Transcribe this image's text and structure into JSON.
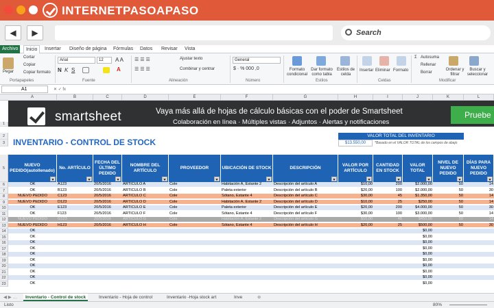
{
  "brand": {
    "name": "INTERNETPASOAPASO"
  },
  "browser": {
    "search_label": "Search"
  },
  "ribbon": {
    "tabs": [
      "Archivo",
      "Inicio",
      "Insertar",
      "Diseño de página",
      "Fórmulas",
      "Datos",
      "Revisar",
      "Vista"
    ],
    "paste": "Pegar",
    "clip": [
      "Cortar",
      "Copiar",
      "Copiar formato"
    ],
    "font_name": "Arial",
    "font_size": "12",
    "wrap": "Ajustar texto",
    "merge": "Combinar y centrar",
    "number_format": "General",
    "cond_format": "Formato condicional",
    "table_format": "Dar formato como tabla",
    "cell_styles": "Estilos de celda",
    "insert": "Insertar",
    "delete": "Eliminar",
    "format": "Formato",
    "autosum": "Autosuma",
    "fill": "Rellenar",
    "clear": "Borrar",
    "sort": "Ordenar y filtrar",
    "find": "Buscar y seleccionar",
    "groups": [
      "Portapapeles",
      "Fuente",
      "Alineación",
      "Número",
      "Estilos",
      "Celdas",
      "Modificar"
    ]
  },
  "formula_bar": {
    "cell_ref": "A1"
  },
  "columns": [
    "A",
    "B",
    "C",
    "D",
    "E",
    "F",
    "G",
    "H",
    "I",
    "J",
    "K",
    "L"
  ],
  "banner": {
    "logo": "smartsheet",
    "line1": "Vaya más allá de hojas de cálculo básicas con el poder de Smartsheet",
    "line2": "Colaboración en línea · Múltiples vistas · Adjuntos · Alertas y notificaciones",
    "cta": "Pruebe"
  },
  "inventory": {
    "title": "INVENTARIO - CONTROL DE STOCK",
    "total_label": "VALOR TOTAL DEL INVENTARIO",
    "total_value": "$13.550,00",
    "total_note": "*Basado en el VALOR TOTAL de los campos de abajo",
    "headers": [
      "NUEVO PEDIDO(autollenado)",
      "No. ARTÍCULO",
      "FECHA DEL ÚLTIMO PEDIDO",
      "NOMBRE DEL ARTÍCULO",
      "PROVEEDOR",
      "UBICACIÓN DE STOCK",
      "DESCRIPCIÓN",
      "VALOR POR ARTÍCULO",
      "CANTIDAD EN STOCK",
      "VALOR TOTAL",
      "NIVEL DE NUEVO PEDIDO",
      "DÍAS PARA NUEVO PEDIDO"
    ],
    "rows": [
      {
        "status": "OK",
        "item": "A123",
        "date": "20/5/2016",
        "name": "ARTÍCULO A",
        "supplier": "Cole",
        "location": "Habitación A, Estante 2",
        "desc": "Descripción del artículo A",
        "unit": "$10,00",
        "qty": "200",
        "total": "$2.000,00",
        "level": "50",
        "days": "14"
      },
      {
        "status": "OK",
        "item": "B123",
        "date": "20/5/2016",
        "name": "ARTÍCULO B",
        "supplier": "Cole",
        "location": "Paleta exterior",
        "desc": "Descripción del artículo B",
        "unit": "$20,00",
        "qty": "100",
        "total": "$2.000,00",
        "level": "50",
        "days": "30"
      },
      {
        "status": "NUEVO PEDIDO",
        "item": "C123",
        "date": "20/5/2016",
        "name": "ARTÍCULO C",
        "supplier": "Cole",
        "location": "Sótano, Estante 4",
        "desc": "Descripción del artículo C",
        "unit": "$30,00",
        "qty": "45",
        "total": "$1.350,00",
        "level": "50",
        "days": "14"
      },
      {
        "status": "NUEVO PEDIDO",
        "item": "D123",
        "date": "20/5/2016",
        "name": "ARTÍCULO D",
        "supplier": "Cole",
        "location": "Habitación A, Estante 2",
        "desc": "Descripción del artículo D",
        "unit": "$10,00",
        "qty": "25",
        "total": "$250,00",
        "level": "50",
        "days": "14"
      },
      {
        "status": "OK",
        "item": "E123",
        "date": "20/5/2016",
        "name": "ARTÍCULO E",
        "supplier": "Cole",
        "location": "Paleta exterior",
        "desc": "Descripción del artículo E",
        "unit": "$20,00",
        "qty": "200",
        "total": "$4.000,00",
        "level": "50",
        "days": "30"
      },
      {
        "status": "OK",
        "item": "F123",
        "date": "20/5/2016",
        "name": "ARTÍCULO F",
        "supplier": "Cole",
        "location": "Sótano, Estante 4",
        "desc": "Descripción del artículo F",
        "unit": "$30,00",
        "qty": "100",
        "total": "$3.000,00",
        "level": "50",
        "days": "14"
      },
      {
        "status": "NUEVO PEDIDO",
        "item": "G123",
        "date": "20/5/2016",
        "name": "ARTÍCULO G",
        "supplier": "Cole",
        "location": "Habitación A, Estante 2",
        "desc": "Descripción del artículo G",
        "unit": "$10,00",
        "qty": "45",
        "total": "$450,00",
        "level": "50",
        "days": "14"
      },
      {
        "status": "NUEVO PEDIDO",
        "item": "H123",
        "date": "20/5/2016",
        "name": "ARTÍCULO H",
        "supplier": "Cole",
        "location": "Sótano, Estante 4",
        "desc": "Descripción del artículo H",
        "unit": "$20,00",
        "qty": "25",
        "total": "$500,00",
        "level": "50",
        "days": "30"
      }
    ],
    "empty_status": "OK",
    "empty_total": "$0,00",
    "empty_count": 10
  },
  "row_numbers": [
    "1",
    "2",
    "3",
    "5",
    "6",
    "7",
    "8",
    "9",
    "10",
    "11",
    "12",
    "13",
    "14",
    "15",
    "16",
    "17",
    "18",
    "19",
    "20",
    "21",
    "22",
    "23"
  ],
  "sheet_tabs": [
    "Inventario - Control de stock",
    "Inventario - Hoja de control",
    "Inventario -Hoja stock art",
    "Inve"
  ],
  "status": {
    "ready": "Listo",
    "zoom": "80%"
  },
  "colors": {
    "header_blue": "#1f63b4",
    "reorder_orange": "#f6b18f",
    "stripe_blue": "#dbe5f3",
    "grey": "#a9a9a9",
    "brand_red": "#e05a3a"
  }
}
